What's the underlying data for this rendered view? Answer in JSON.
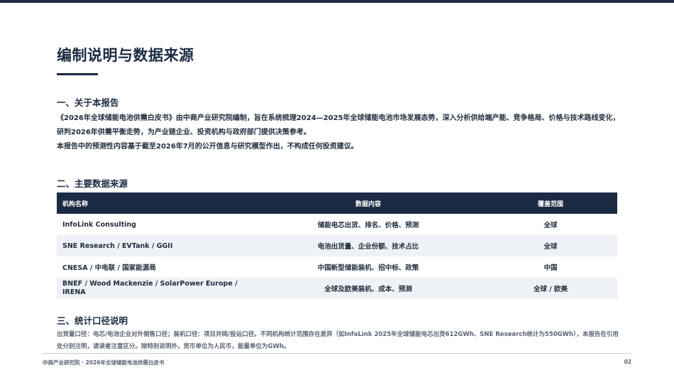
{
  "page": {
    "title": "编制说明与数据来源",
    "accent_color": "#1b2b44"
  },
  "section1": {
    "heading": "一、关于本报告",
    "para1": "《2026年全球储能电池供需白皮书》由中商产业研究院编制，旨在系统梳理2024—2025年全球储能电池市场发展态势，深入分析供给端产能、竞争格局、价格与技术路线变化，研判2026年供需平衡走势，为产业链企业、投资机构与政府部门提供决策参考。",
    "para2": "本报告中的预测性内容基于截至2026年7月的公开信息与研究模型作出，不构成任何投资建议。"
  },
  "section2": {
    "heading": "二、主要数据来源",
    "columns": [
      "机构名称",
      "数据内容",
      "覆盖范围"
    ],
    "rows": [
      {
        "org": "InfoLink Consulting",
        "content": "储能电芯出货、排名、价格、预测",
        "scope": "全球"
      },
      {
        "org": "SNE Research / EVTank / GGII",
        "content": "电池出货量、企业份额、技术占比",
        "scope": "全球"
      },
      {
        "org": "CNESA / 中电联 / 国家能源局",
        "content": "中国新型储能装机、招中标、政策",
        "scope": "中国"
      },
      {
        "org": "BNEF / Wood Mackenzie / SolarPower Europe / IRENA",
        "content": "全球及欧美装机、成本、预测",
        "scope": "全球 / 欧美"
      }
    ]
  },
  "section3": {
    "heading": "三、统计口径说明",
    "note": "出货量口径：电芯/电池企业对外销售口径；装机口径：项目并网/投运口径。不同机构统计范围存在差异（如InfoLink 2025年全球储能电芯出货612GWh、SNE Research统计为550GWh），本报告在引用处分别注明，请读者注意区分。除特别说明外，货币单位为人民币，能量单位为GWh。"
  },
  "footer": {
    "left": "中商产业研究院 · 2026年全球储能电池供需白皮书",
    "page_number": "02"
  }
}
